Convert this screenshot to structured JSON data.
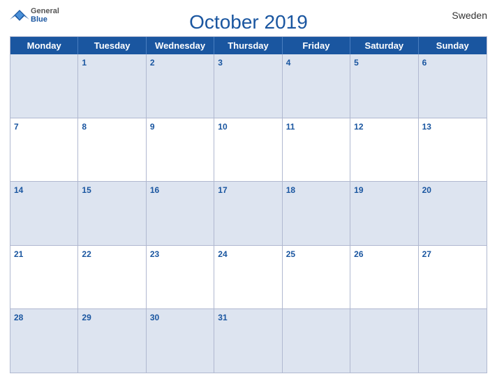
{
  "logo": {
    "general": "General",
    "blue": "Blue"
  },
  "header": {
    "title": "October 2019",
    "country": "Sweden"
  },
  "day_headers": [
    "Monday",
    "Tuesday",
    "Wednesday",
    "Thursday",
    "Friday",
    "Saturday",
    "Sunday"
  ],
  "weeks": [
    [
      {
        "num": "",
        "empty": true
      },
      {
        "num": "1"
      },
      {
        "num": "2"
      },
      {
        "num": "3"
      },
      {
        "num": "4"
      },
      {
        "num": "5"
      },
      {
        "num": "6"
      }
    ],
    [
      {
        "num": "7"
      },
      {
        "num": "8"
      },
      {
        "num": "9"
      },
      {
        "num": "10"
      },
      {
        "num": "11"
      },
      {
        "num": "12"
      },
      {
        "num": "13"
      }
    ],
    [
      {
        "num": "14"
      },
      {
        "num": "15"
      },
      {
        "num": "16"
      },
      {
        "num": "17"
      },
      {
        "num": "18"
      },
      {
        "num": "19"
      },
      {
        "num": "20"
      }
    ],
    [
      {
        "num": "21"
      },
      {
        "num": "22"
      },
      {
        "num": "23"
      },
      {
        "num": "24"
      },
      {
        "num": "25"
      },
      {
        "num": "26"
      },
      {
        "num": "27"
      }
    ],
    [
      {
        "num": "28"
      },
      {
        "num": "29"
      },
      {
        "num": "30"
      },
      {
        "num": "31"
      },
      {
        "num": "",
        "empty": true
      },
      {
        "num": "",
        "empty": true
      },
      {
        "num": "",
        "empty": true
      }
    ]
  ],
  "shaded_weeks": [
    0,
    2,
    4
  ]
}
